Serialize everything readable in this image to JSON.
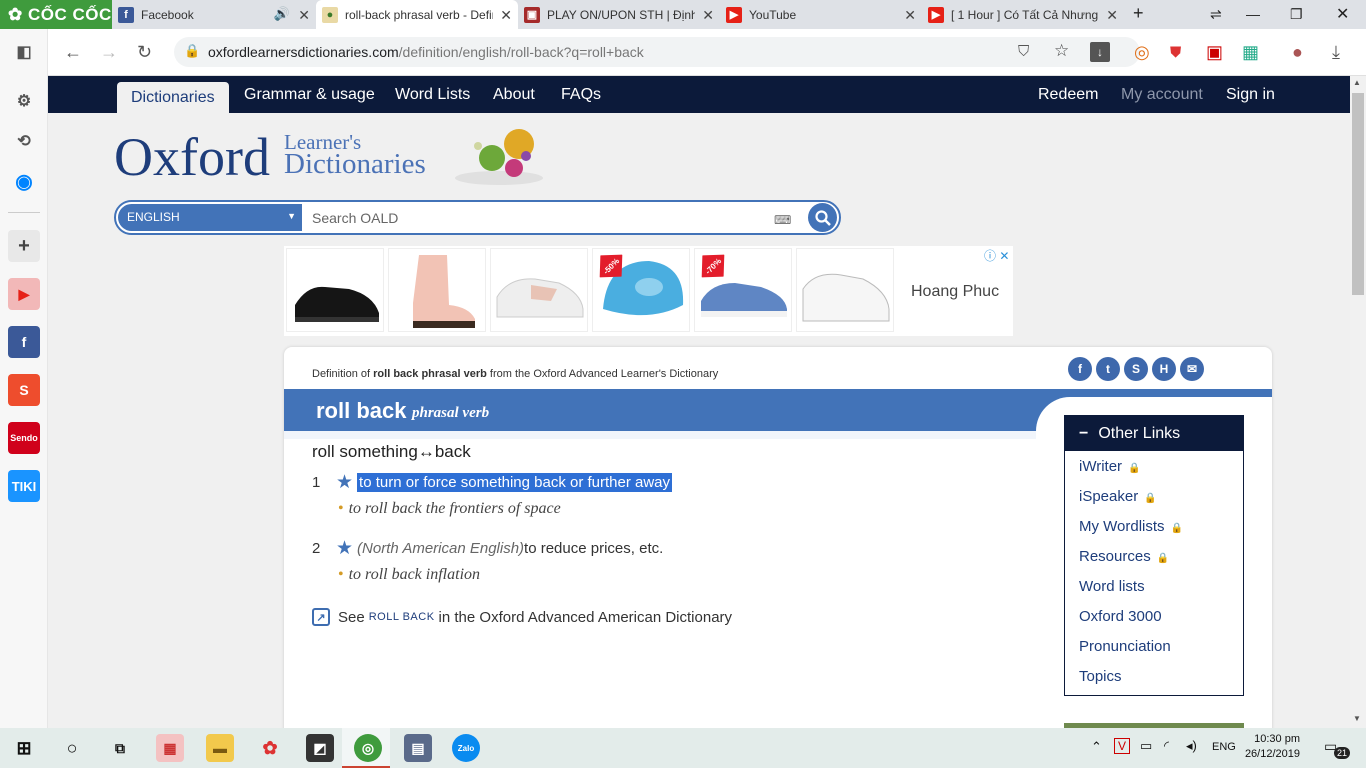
{
  "browser": {
    "brand": "CỐC CỐC",
    "tabs": [
      {
        "label": "Facebook",
        "icon": "facebook-icon"
      },
      {
        "label": "roll-back phrasal verb - Definition",
        "icon": "oxford-favicon-icon"
      },
      {
        "label": "PLAY ON/UPON STH | Định",
        "icon": "cambridge-favicon-icon"
      },
      {
        "label": "YouTube",
        "icon": "youtube-icon"
      },
      {
        "label": "[ 1 Hour ] Có Tất Cả Nhưng",
        "icon": "youtube-icon"
      }
    ],
    "url_domain": "oxfordlearnersdictionaries.com",
    "url_path": "/definition/english/roll-back?q=roll+back"
  },
  "site": {
    "nav": {
      "dictionaries": "Dictionaries",
      "grammar": "Grammar & usage",
      "word_lists": "Word Lists",
      "about": "About",
      "faqs": "FAQs",
      "redeem": "Redeem",
      "my_account": "My account",
      "sign_in": "Sign in"
    },
    "logo": {
      "oxford": "Oxford",
      "learners": "Learner's",
      "dictionaries": "Dictionaries"
    },
    "search": {
      "language": "ENGLISH",
      "placeholder": "Search OALD"
    }
  },
  "ad": {
    "badges": [
      "-50%",
      "-70%"
    ],
    "brand": "Hoang Phuc"
  },
  "entry": {
    "source_prefix": "Definition of ",
    "source_bold": "roll back phrasal verb",
    "source_suffix": " from the Oxford Advanced Learner's Dictionary",
    "headword": "roll back",
    "pos": "phrasal verb",
    "pattern": "roll something↔back",
    "senses": [
      {
        "num": "1",
        "definition": "to turn or force something back or further away",
        "example": "to roll back the frontiers of space"
      },
      {
        "num": "2",
        "register": "(North American English)",
        "definition": " to reduce prices, etc.",
        "example": "to roll back inflation"
      }
    ],
    "see_also": {
      "prefix": "See ",
      "term": "ROLL BACK",
      "suffix": " in the Oxford Advanced American Dictionary"
    }
  },
  "other_links": {
    "title": "Other Links",
    "items": [
      {
        "label": "iWriter",
        "locked": true
      },
      {
        "label": "iSpeaker",
        "locked": true
      },
      {
        "label": "My Wordlists",
        "locked": true
      },
      {
        "label": "Resources",
        "locked": true
      },
      {
        "label": "Word lists",
        "locked": false
      },
      {
        "label": "Oxford 3000",
        "locked": false
      },
      {
        "label": "Pronunciation",
        "locked": false
      },
      {
        "label": "Topics",
        "locked": false
      }
    ]
  },
  "taskbar": {
    "language": "ENG",
    "time": "10:30 pm",
    "date": "26/12/2019",
    "notifications": "21"
  },
  "colors": {
    "navy": "#0c1a3a",
    "oxford_blue": "#4273b8",
    "highlight": "#2e6fd5"
  }
}
